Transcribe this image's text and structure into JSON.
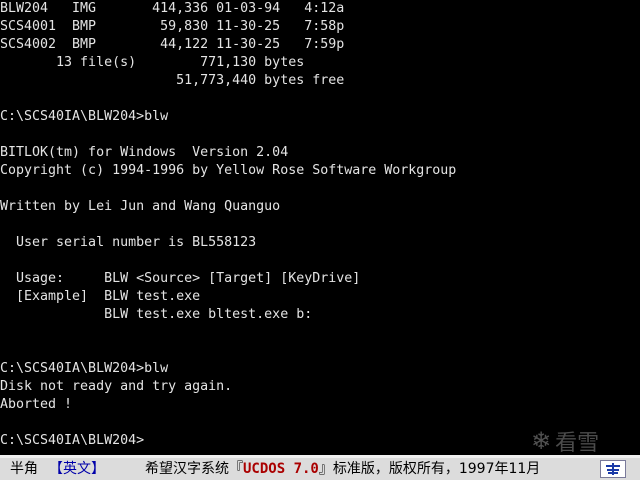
{
  "terminal": {
    "lines": [
      "BLW204   IMG       414,336 01-03-94   4:12a",
      "SCS4001  BMP        59,830 11-30-25   7:58p",
      "SCS4002  BMP        44,122 11-30-25   7:59p",
      "       13 file(s)        771,130 bytes",
      "                      51,773,440 bytes free",
      "",
      "C:\\SCS40IA\\BLW204>blw",
      "",
      "BITLOK(tm) for Windows  Version 2.04",
      "Copyright (c) 1994-1996 by Yellow Rose Software Workgroup",
      "",
      "Written by Lei Jun and Wang Quanguo",
      "",
      "  User serial number is BL558123",
      "",
      "  Usage:     BLW <Source> [Target] [KeyDrive]",
      "  [Example]  BLW test.exe",
      "             BLW test.exe bltest.exe b:",
      "",
      "",
      "C:\\SCS40IA\\BLW204>blw",
      "Disk not ready and try again.",
      "Aborted !",
      "",
      "C:\\SCS40IA\\BLW204>"
    ]
  },
  "watermark": {
    "icon": "snowflake-icon",
    "text": "看雪"
  },
  "statusbar": {
    "mode": "半角",
    "ime": "【英文】",
    "banner_pre": "希望汉字系统『",
    "banner_brand": "UCDOS 7.0",
    "banner_post": "』标准版，版权所有，1997年11月",
    "icon": "ime-indicator-icon"
  },
  "colors": {
    "background": "#000000",
    "text": "#e4e4e4",
    "statusbar_bg": "#dcdcdc",
    "brand": "#aa0000",
    "ime": "#0000aa"
  }
}
